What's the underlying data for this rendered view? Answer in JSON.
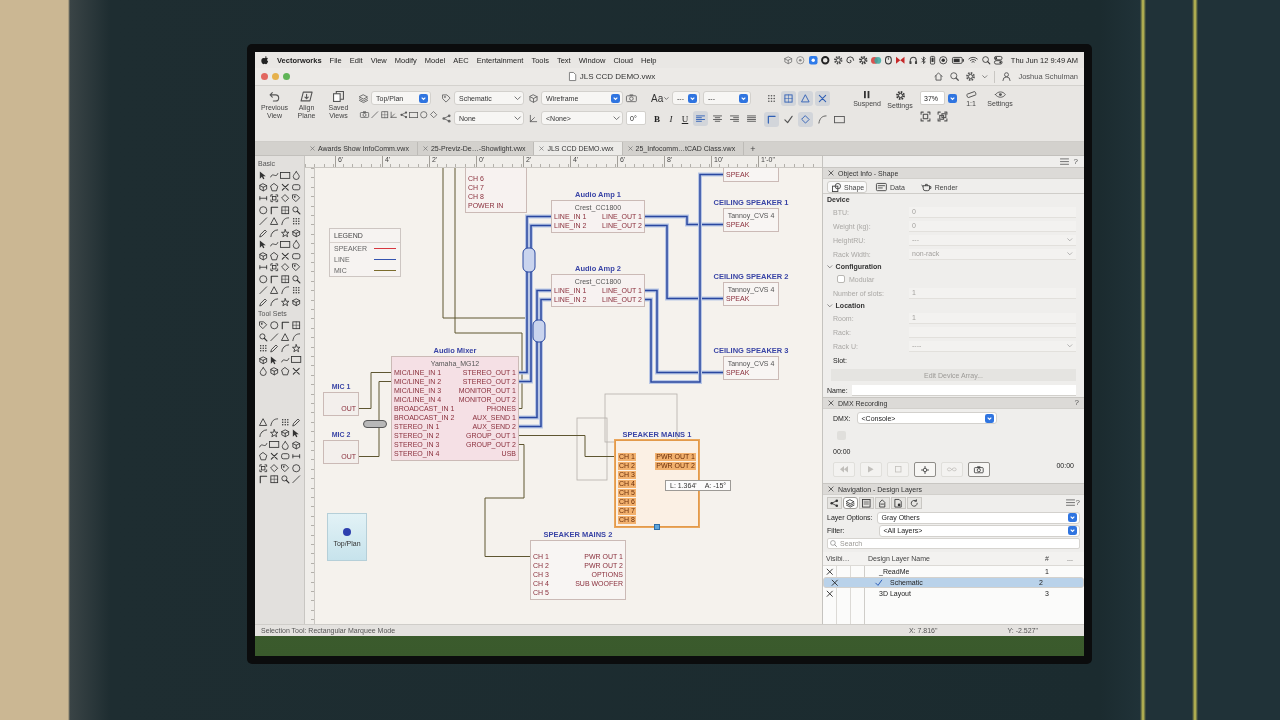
{
  "menu_bar": {
    "app_name": "Vectorworks",
    "menus": [
      "File",
      "Edit",
      "View",
      "Modify",
      "Model",
      "AEC",
      "Entertainment",
      "Tools",
      "Text",
      "Window",
      "Cloud",
      "Help"
    ],
    "clock": "Thu Jun 12 9:49 AM"
  },
  "title_bar": {
    "document": "JLS CCD DEMO.vwx",
    "user": "Joshua Schulman"
  },
  "toolbar": {
    "view_buttons": [
      "Previous View",
      "Align Plane",
      "Saved Views"
    ],
    "view": "Top/Plan",
    "active_class": "Schematic",
    "class_filter": "None",
    "render_mode": "Wireframe",
    "working_plane": "<None>",
    "angle": "0°",
    "font_menu": "Aa",
    "font": "---",
    "font_size": "---",
    "text_styles": [
      {
        "label": "B",
        "kind": "bold"
      },
      {
        "label": "I",
        "kind": "italic"
      },
      {
        "label": "U",
        "kind": "underline"
      }
    ],
    "text_alignment": [
      {
        "selected": true
      },
      {
        "selected": false
      },
      {
        "selected": false
      },
      {
        "selected": false
      }
    ],
    "snap_toggles": [
      {
        "on": false
      },
      {
        "on": true
      },
      {
        "on": true
      },
      {
        "on": true
      },
      {
        "on": true
      },
      {
        "on": false
      },
      {
        "on": true
      },
      {
        "on": false
      },
      {
        "on": false
      }
    ],
    "suspend": "Suspend",
    "snap_settings": "Settings",
    "zoom": "37%",
    "scale": "1:1",
    "view_settings": "Settings"
  },
  "document_tabs": [
    {
      "label": "Awards Show InfoComm.vwx",
      "selected": false
    },
    {
      "label": "25-Previz-De…-Showlight.vwx",
      "selected": false
    },
    {
      "label": "JLS CCD DEMO.vwx",
      "selected": true
    },
    {
      "label": "25_Infocomm…tCAD Class.vwx",
      "selected": false
    }
  ],
  "new_tab": "+",
  "tool_palette": {
    "basic_title": "Basic",
    "sets_title": "Tool Sets"
  },
  "drawing": {
    "ruler_labels": [
      "6'",
      "4'",
      "2'",
      "0'",
      "2'",
      "4'",
      "6'",
      "8'",
      "10'",
      "1'-0\""
    ],
    "legend": {
      "title": "LEGEND",
      "items": [
        {
          "label": "SPEAKER",
          "color": "#d7373f"
        },
        {
          "label": "LINE",
          "color": "#3554b0"
        },
        {
          "label": "MIC",
          "color": "#7b6c2c"
        }
      ]
    },
    "nodes": [
      {
        "kind": "patch",
        "inputs": [
          "CH 6",
          "CH 7",
          "CH 8",
          "POWER IN"
        ],
        "selected": false
      },
      {
        "kind": "speaker",
        "inputs": [
          "SPEAK"
        ],
        "selected": false
      },
      {
        "kind": "amplifier",
        "title": "Audio Amp 1",
        "model": "Crest_CC1800",
        "inputs": [
          "LINE_IN 1",
          "LINE_IN 2"
        ],
        "outputs": [
          "LINE_OUT 1",
          "LINE_OUT 2"
        ],
        "selected": false
      },
      {
        "kind": "speaker",
        "title": "CEILING SPEAKER 1",
        "model": "Tannoy_CVS 4",
        "inputs": [
          "SPEAK"
        ],
        "selected": false
      },
      {
        "kind": "amplifier",
        "title": "Audio Amp 2",
        "model": "Crest_CC1800",
        "inputs": [
          "LINE_IN 1",
          "LINE_IN 2"
        ],
        "outputs": [
          "LINE_OUT 1",
          "LINE_OUT 2"
        ],
        "selected": false
      },
      {
        "kind": "speaker",
        "title": "CEILING SPEAKER 2",
        "model": "Tannoy_CVS 4",
        "inputs": [
          "SPEAK"
        ],
        "selected": false
      },
      {
        "kind": "mixer",
        "title": "Audio Mixer",
        "model": "Yamaha_MG12",
        "inputs": [
          "MIC/LINE_IN 1",
          "MIC/LINE_IN 2",
          "MIC/LINE_IN 3",
          "MIC/LINE_IN 4",
          "BROADCAST_IN 1",
          "BROADCAST_IN 2",
          "STEREO_IN 1",
          "STEREO_IN 2",
          "STEREO_IN 3",
          "STEREO_IN 4"
        ],
        "outputs": [
          "STEREO_OUT 1",
          "STEREO_OUT 2",
          "MONITOR_OUT 1",
          "MONITOR_OUT 2",
          "PHONES",
          "AUX_SEND 1",
          "AUX_SEND 2",
          "GROUP_OUT 1",
          "GROUP_OUT 2",
          "USB"
        ],
        "selected": false
      },
      {
        "kind": "speaker",
        "title": "CEILING SPEAKER 3",
        "model": "Tannoy_CVS 4",
        "inputs": [
          "SPEAK"
        ],
        "selected": false
      },
      {
        "kind": "microphone",
        "title": "MIC 1",
        "outputs": [
          "OUT"
        ],
        "selected": false
      },
      {
        "kind": "microphone",
        "title": "MIC 2",
        "outputs": [
          "OUT"
        ],
        "selected": false
      },
      {
        "kind": "speaker",
        "title": "SPEAKER MAINS 1",
        "inputs": [
          "CH 1",
          "CH 2",
          "CH 3",
          "CH 4",
          "CH 5",
          "CH 6",
          "CH 7",
          "CH 8"
        ],
        "outputs": [
          "PWR OUT 1",
          "PWR OUT 2"
        ],
        "selected": true
      },
      {
        "kind": "speaker",
        "title": "SPEAKER MAINS 2",
        "inputs": [
          "CH 1",
          "CH 2",
          "CH 3",
          "CH 4",
          "CH 5"
        ],
        "outputs": [
          "PWR OUT 1",
          "PWR OUT 2",
          "OPTIONS",
          "SUB WOOFER"
        ],
        "selected": false
      }
    ],
    "dimension": {
      "length": "L: 1.364'",
      "angle": "A: -15°"
    },
    "view_tile": "Top/Plan"
  },
  "object_info": {
    "help": "?",
    "title": "Object Info - Shape",
    "tabs": [
      {
        "label": "Shape",
        "selected": true
      },
      {
        "label": "Data",
        "selected": false
      },
      {
        "label": "Render",
        "selected": false
      }
    ],
    "sections": [
      {
        "heading": "Device",
        "fields": [
          {
            "label": "BTU:",
            "value": "0",
            "kind": "text",
            "disabled": true
          },
          {
            "label": "Weight (kg):",
            "value": "0",
            "kind": "text",
            "disabled": true
          },
          {
            "label": "HeightRU:",
            "value": "---",
            "kind": "select",
            "disabled": true
          },
          {
            "label": "Rack Width:",
            "value": "non-rack",
            "kind": "select",
            "disabled": true
          }
        ]
      },
      {
        "heading": "Configuration",
        "expanded": true,
        "fields": [
          {
            "label": "Modular",
            "kind": "checkbox",
            "checked": false,
            "disabled": true
          },
          {
            "label": "Number of slots:",
            "value": "1",
            "kind": "text",
            "disabled": true
          }
        ]
      },
      {
        "heading": "Location",
        "expanded": true,
        "fields": [
          {
            "label": "Room:",
            "value": "1",
            "kind": "text",
            "disabled": true
          },
          {
            "label": "Rack:",
            "kind": "text",
            "disabled": true
          },
          {
            "label": "Rack U:",
            "value": "----",
            "kind": "select",
            "disabled": true
          },
          {
            "label": "Slot:",
            "kind": "label"
          }
        ]
      }
    ],
    "action": {
      "label": "Edit Device Array...",
      "disabled": true
    },
    "name_label": "Name:"
  },
  "dmx_recording": {
    "title": "DMX Recording",
    "help": "?",
    "dmx_label": "DMX:",
    "source": "<Console>",
    "start_time": "00:00",
    "end_time": "00:00",
    "transport": [
      {
        "enabled": false
      },
      {
        "enabled": false
      },
      {
        "enabled": false
      },
      {
        "enabled": true
      },
      {
        "enabled": false
      },
      {
        "enabled": true
      }
    ]
  },
  "navigation": {
    "title": "Navigation - Design Layers",
    "help": "?",
    "tabs": [
      {
        "selected": false
      },
      {
        "selected": true
      },
      {
        "selected": false
      },
      {
        "selected": false
      },
      {
        "selected": false
      },
      {
        "selected": false
      }
    ],
    "layer_options_label": "Layer Options:",
    "layer_options": "Gray Others",
    "filter_label": "Filter:",
    "filter": "<All Layers>",
    "search_placeholder": "Search",
    "columns": [
      "Visibi…",
      "Design Layer Name",
      "#",
      "..."
    ],
    "rows": [
      {
        "name": "_ReadMe",
        "number": "1",
        "visible": true,
        "active": false,
        "selected": false
      },
      {
        "name": "Schematic",
        "number": "2",
        "visible": true,
        "active": true,
        "selected": true
      },
      {
        "name": "3D Layout",
        "number": "3",
        "visible": true,
        "active": false,
        "selected": false
      }
    ]
  },
  "status_bar": {
    "message": "Selection Tool: Rectangular Marquee Mode",
    "x": "X: 7.816\"",
    "y": "Y: -2.527\""
  }
}
